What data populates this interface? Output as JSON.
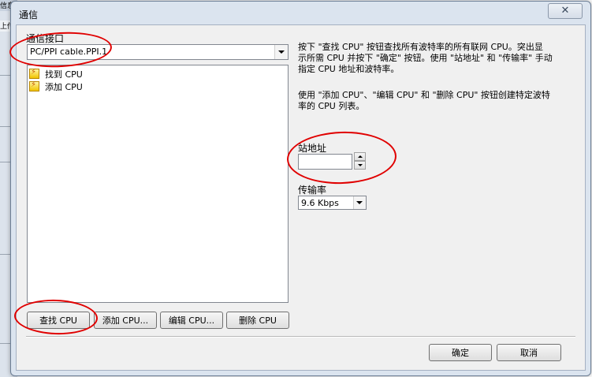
{
  "background_app": {
    "tab_top": "信息",
    "tab_second": "上传"
  },
  "window": {
    "title": "通信",
    "close_symbol": "✕"
  },
  "interface": {
    "label": "通信接口",
    "value": "PC/PPI cable.PPI.1"
  },
  "cpu_tree": {
    "items": [
      {
        "label": "找到 CPU",
        "icon": "cpu-lightning-icon"
      },
      {
        "label": "添加 CPU",
        "icon": "cpu-lightning-icon"
      }
    ]
  },
  "buttons": {
    "find_cpu": "查找 CPU",
    "add_cpu": "添加 CPU...",
    "edit_cpu": "编辑 CPU...",
    "delete_cpu": "删除 CPU",
    "ok": "确定",
    "cancel": "取消"
  },
  "help": {
    "line1": "按下 \"查找 CPU\" 按钮查找所有波特率的所有联网 CPU。突出显",
    "line2": "示所需 CPU 并按下 \"确定\" 按钮。使用 \"站地址\" 和 \"传输率\" 手动",
    "line3": "指定 CPU 地址和波特率。",
    "line4": "使用 \"添加 CPU\"、\"编辑 CPU\" 和 \"删除 CPU\" 按钮创建特定波特",
    "line5": "率的 CPU 列表。"
  },
  "station": {
    "label": "站地址",
    "value": ""
  },
  "baud": {
    "label": "传输率",
    "value": "9.6 Kbps"
  },
  "colors": {
    "annotation": "#e00000",
    "dialog_frame": "#dbe4ef",
    "client_bg": "#f0f0f0"
  }
}
